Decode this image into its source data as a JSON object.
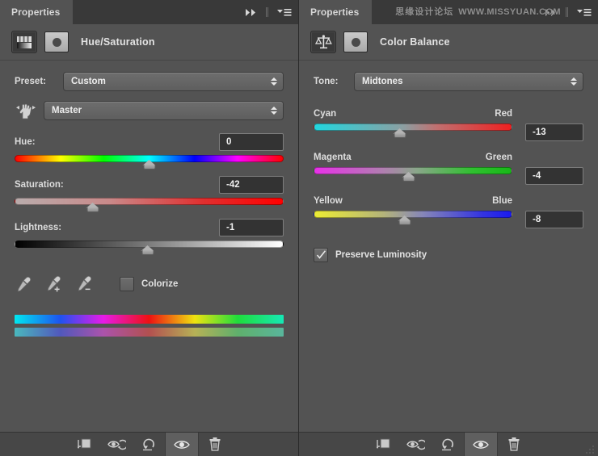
{
  "left_panel": {
    "tab_label": "Properties",
    "collapse_icon": "double-chevron-right-icon",
    "menu_icon": "panel-menu-icon",
    "adjustment_icon": "hue-saturation-icon",
    "mask_icon": "layer-mask-thumbnail",
    "title": "Hue/Saturation",
    "preset": {
      "label": "Preset:",
      "value": "Custom"
    },
    "channel": {
      "icon": "scrubby-hand-icon",
      "value": "Master"
    },
    "sliders": [
      {
        "name": "hue",
        "label": "Hue:",
        "value": "0",
        "percent": 50.0,
        "track": "hue"
      },
      {
        "name": "saturation",
        "label": "Saturation:",
        "value": "-42",
        "percent": 29.0,
        "track": "saturation"
      },
      {
        "name": "lightness",
        "label": "Lightness:",
        "value": "-1",
        "percent": 49.5,
        "track": "lightness"
      }
    ],
    "eyedroppers": [
      {
        "name": "eyedropper-sample-icon"
      },
      {
        "name": "eyedropper-add-icon"
      },
      {
        "name": "eyedropper-subtract-icon"
      }
    ],
    "colorize": {
      "label": "Colorize",
      "checked": false
    },
    "spectrum_bars": [
      "full-spectrum-bar",
      "adjusted-spectrum-bar"
    ]
  },
  "right_panel": {
    "tab_label": "Properties",
    "watermark_cn": "思缘设计论坛",
    "watermark_url": "WWW.MISSYUAN.COM",
    "collapse_icon": "double-chevron-right-icon",
    "menu_icon": "panel-menu-icon",
    "adjustment_icon": "color-balance-icon",
    "mask_icon": "layer-mask-thumbnail",
    "title": "Color Balance",
    "tone": {
      "label": "Tone:",
      "value": "Midtones"
    },
    "sliders": [
      {
        "name": "cyan-red",
        "left_label": "Cyan",
        "right_label": "Red",
        "value": "-13",
        "percent": 43.5,
        "track": "cyan-red"
      },
      {
        "name": "magenta-green",
        "left_label": "Magenta",
        "right_label": "Green",
        "value": "-4",
        "percent": 48.0,
        "track": "magenta-green"
      },
      {
        "name": "yellow-blue",
        "left_label": "Yellow",
        "right_label": "Blue",
        "value": "-8",
        "percent": 46.0,
        "track": "yellow-blue"
      }
    ],
    "preserve_luminosity": {
      "label": "Preserve Luminosity",
      "checked": true
    }
  },
  "bottom_toolbar": {
    "buttons": [
      {
        "name": "clip-to-layer-button",
        "icon": "clip-to-layer-icon",
        "active": false
      },
      {
        "name": "view-previous-state-button",
        "icon": "eye-previous-icon",
        "active": false
      },
      {
        "name": "reset-button",
        "icon": "reset-arrow-icon",
        "active": false
      },
      {
        "name": "toggle-visibility-button",
        "icon": "eye-icon",
        "active": true
      },
      {
        "name": "delete-adjustment-button",
        "icon": "trash-icon",
        "active": false
      }
    ]
  },
  "colors": {
    "panel_bg": "#535353",
    "tabbar_bg": "#393939",
    "field_bg": "#333333",
    "text": "#e3e3e3",
    "toolbar_bg": "#474747"
  }
}
